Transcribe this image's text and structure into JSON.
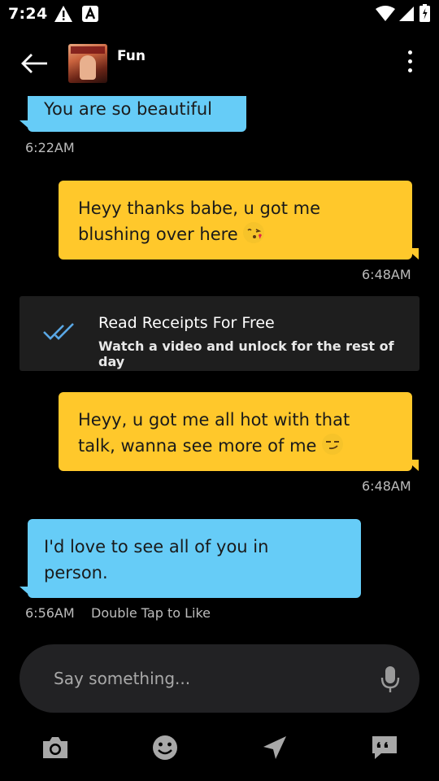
{
  "status_bar": {
    "time": "7:24"
  },
  "header": {
    "title": "Fun"
  },
  "messages": [
    {
      "direction": "incoming",
      "text": "You are so beautiful",
      "time": "6:22AM"
    },
    {
      "direction": "outgoing",
      "line1": "Heyy thanks babe, u got me",
      "line2": "blushing over here",
      "emoji": "kissing-face-emoji",
      "time": "6:48AM"
    },
    {
      "direction": "outgoing",
      "line1": "Heyy, u got me all hot with that",
      "line2": "talk, wanna see more of me",
      "emoji": "smirking-face-emoji",
      "time": "6:48AM"
    },
    {
      "direction": "incoming",
      "line1": "I'd love to see all of you in",
      "line2": "person.",
      "time": "6:56AM",
      "hint": "Double Tap to Like"
    }
  ],
  "read_receipts": {
    "title": "Read Receipts For Free",
    "subtitle": "Watch a video and unlock for the rest of day",
    "icon": "double-check-icon"
  },
  "composer": {
    "placeholder": "Say something..."
  },
  "toolbar": {
    "items": [
      "camera-icon",
      "emoji-icon",
      "location-icon",
      "quote-icon"
    ]
  },
  "colors": {
    "incoming_bubble": "#66ccf7",
    "outgoing_bubble": "#ffc82b",
    "background": "#000000"
  }
}
